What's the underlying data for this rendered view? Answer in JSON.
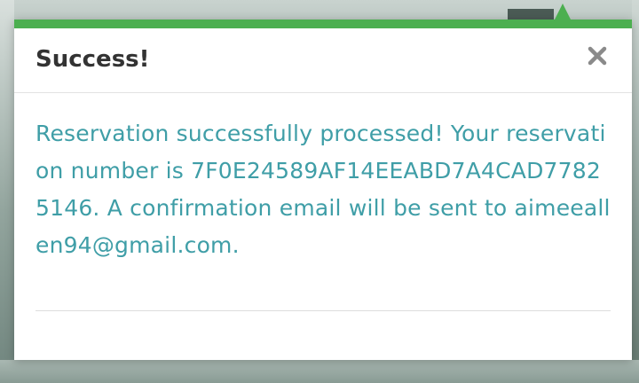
{
  "modal": {
    "title": "Success!",
    "close_icon": "close-icon",
    "message": "Reservation successfully processed! Your reservation number is 7F0E24589AF14EEABD7A4CAD77825146. A confirmation email will be sent to aimeeallen94@gmail.com."
  },
  "colors": {
    "accent": "#4caf50",
    "message_text": "#3f9ea7",
    "title_text": "#333333",
    "close_icon": "#8a8a8a"
  }
}
